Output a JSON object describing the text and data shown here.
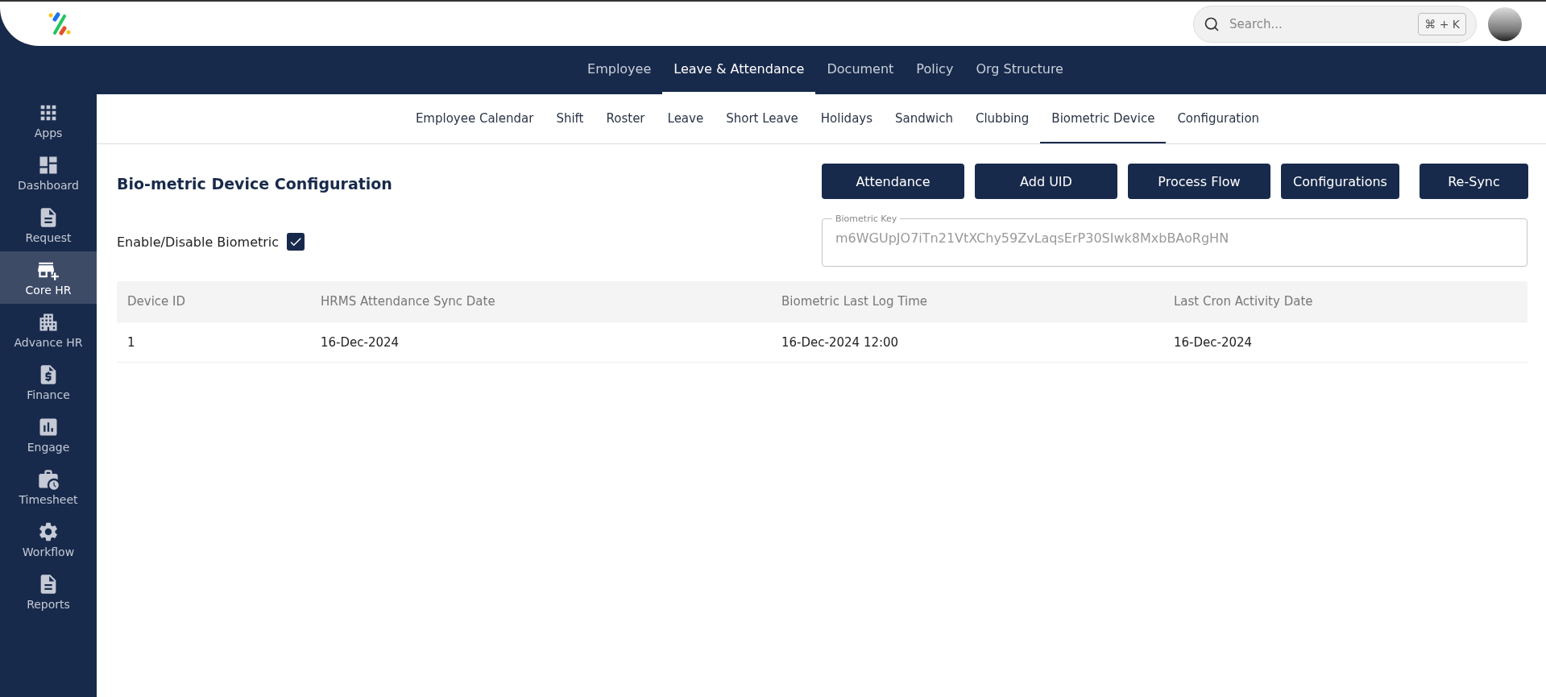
{
  "search": {
    "placeholder": "Search...",
    "shortcut": "⌘ + K"
  },
  "sidebar": {
    "items": [
      {
        "label": "Apps",
        "selected": false
      },
      {
        "label": "Dashboard",
        "selected": false
      },
      {
        "label": "Request",
        "selected": false
      },
      {
        "label": "Core HR",
        "selected": true
      },
      {
        "label": "Advance HR",
        "selected": false
      },
      {
        "label": "Finance",
        "selected": false
      },
      {
        "label": "Engage",
        "selected": false
      },
      {
        "label": "Timesheet",
        "selected": false
      },
      {
        "label": "Workflow",
        "selected": false
      },
      {
        "label": "Reports",
        "selected": false
      }
    ]
  },
  "top_tabs": [
    {
      "label": "Employee",
      "selected": false
    },
    {
      "label": "Leave & Attendance",
      "selected": true
    },
    {
      "label": "Document",
      "selected": false
    },
    {
      "label": "Policy",
      "selected": false
    },
    {
      "label": "Org Structure",
      "selected": false
    }
  ],
  "sub_tabs": [
    {
      "label": "Employee Calendar",
      "selected": false
    },
    {
      "label": "Shift",
      "selected": false
    },
    {
      "label": "Roster",
      "selected": false
    },
    {
      "label": "Leave",
      "selected": false
    },
    {
      "label": "Short Leave",
      "selected": false
    },
    {
      "label": "Holidays",
      "selected": false
    },
    {
      "label": "Sandwich",
      "selected": false
    },
    {
      "label": "Clubbing",
      "selected": false
    },
    {
      "label": "Biometric Device",
      "selected": true
    },
    {
      "label": "Configuration",
      "selected": false
    }
  ],
  "page": {
    "title": "Bio-metric Device Configuration",
    "buttons": [
      "Attendance",
      "Add UID",
      "Process Flow",
      "Configurations",
      "Re-Sync"
    ],
    "enable_biometric": {
      "label": "Enable/Disable Biometric",
      "checked": true
    },
    "biometric_key": {
      "label": "Biometric Key",
      "value": "m6WGUpJO7iTn21VtXChy59ZvLaqsErP30SIwk8MxbBAoRgHN"
    }
  },
  "table": {
    "columns": [
      "Device ID",
      "HRMS Attendance Sync Date",
      "Biometric Last Log Time",
      "Last Cron Activity Date"
    ],
    "rows": [
      [
        "1",
        "16-Dec-2024",
        "16-Dec-2024 12:00",
        "16-Dec-2024"
      ]
    ]
  }
}
